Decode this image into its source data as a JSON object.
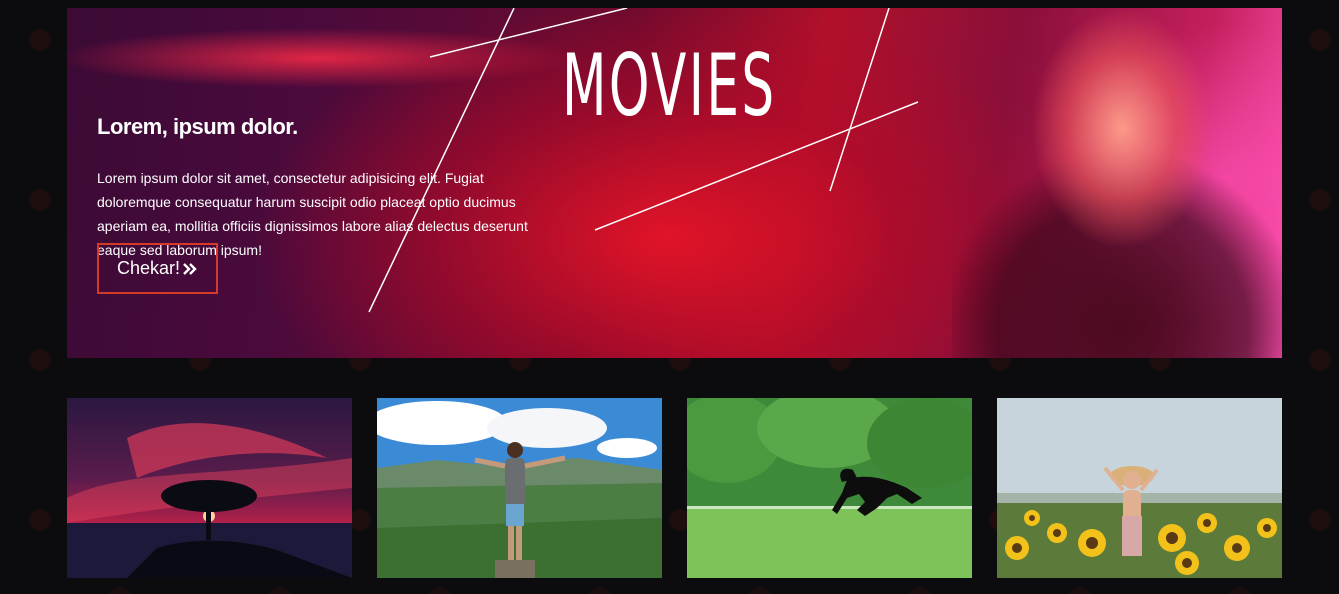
{
  "hero": {
    "title": "MOVIES",
    "heading": "Lorem, ipsum dolor.",
    "text": "Lorem ipsum dolor sit amet, consectetur adipisicing elit. Fugiat doloremque consequatur harum suscipit odio placeat optio ducimus aperiam ea, mollitia officiis dignissimos labore alias delectus deserunt eaque sed laborum ipsum!",
    "button_label": "Chekar!",
    "button_icon": "double-chevron-right-icon",
    "button_border_color": "#d33a2a"
  },
  "gallery": {
    "images": [
      {
        "name": "sunset-tree-image"
      },
      {
        "name": "man-mountain-image"
      },
      {
        "name": "black-horse-image"
      },
      {
        "name": "sunflower-woman-image"
      }
    ]
  },
  "colors": {
    "background": "#0c0c0e",
    "hero_red": "#b2102a",
    "hero_purple": "#4a0a3c",
    "hero_pink": "#ff4fb0"
  }
}
